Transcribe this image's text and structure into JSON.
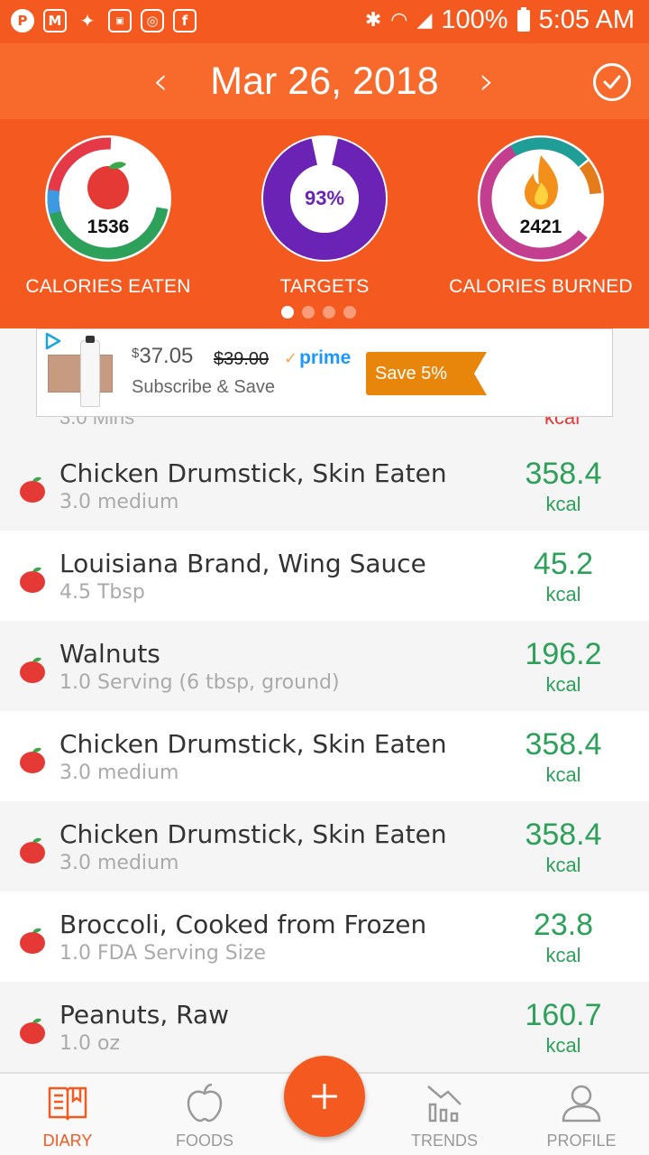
{
  "status_bar": {
    "battery": "100%",
    "time": "5:05 AM",
    "notification_icons": [
      "pinterest-icon",
      "gmail-icon",
      "twitter-icon",
      "badge-icon",
      "instagram-icon",
      "facebook-icon"
    ]
  },
  "header": {
    "date": "Mar 26, 2018"
  },
  "summary": {
    "eaten_value": "1536",
    "eaten_label": "CALORIES EATEN",
    "targets_value": "93%",
    "targets_percent": 93,
    "targets_label": "TARGETS",
    "burned_value": "2421",
    "burned_label": "CALORIES BURNED",
    "page_count": 4,
    "active_page": 1
  },
  "ad": {
    "price": "37.05",
    "price_symbol": "$",
    "old_price": "$39.00",
    "prime_label": "prime",
    "subscribe_label": "Subscribe & Save",
    "save_label": "Save 5%"
  },
  "partial_row": {
    "qty": "3.0 Mins",
    "unit": "kcal"
  },
  "food_items": [
    {
      "name": "Chicken Drumstick, Skin Eaten",
      "qty": "3.0 medium",
      "calories": "358.4",
      "unit": "kcal"
    },
    {
      "name": "Louisiana Brand, Wing Sauce",
      "qty": "4.5 Tbsp",
      "calories": "45.2",
      "unit": "kcal"
    },
    {
      "name": "Walnuts",
      "qty": "1.0 Serving (6 tbsp, ground)",
      "calories": "196.2",
      "unit": "kcal"
    },
    {
      "name": "Chicken Drumstick, Skin Eaten",
      "qty": "3.0 medium",
      "calories": "358.4",
      "unit": "kcal"
    },
    {
      "name": "Chicken Drumstick, Skin Eaten",
      "qty": "3.0 medium",
      "calories": "358.4",
      "unit": "kcal"
    },
    {
      "name": "Broccoli, Cooked from Frozen",
      "qty": "1.0 FDA Serving Size",
      "calories": "23.8",
      "unit": "kcal"
    },
    {
      "name": "Peanuts, Raw",
      "qty": "1.0 oz",
      "calories": "160.7",
      "unit": "kcal"
    }
  ],
  "bottom_nav": {
    "diary": "DIARY",
    "foods": "FOODS",
    "trends": "TRENDS",
    "profile": "PROFILE"
  },
  "colors": {
    "brand_orange": "#f45a20",
    "header_orange": "#f76a2c",
    "calorie_green": "#2da05a",
    "targets_purple": "#6a23b5"
  }
}
